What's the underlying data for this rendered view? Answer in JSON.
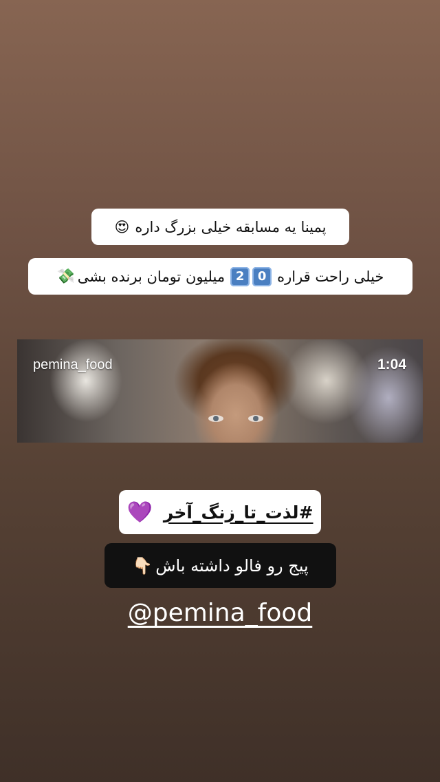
{
  "stickers": {
    "line1": {
      "text": "پمینا یه مسابقه خیلی بزرگ داره",
      "emoji": "😍"
    },
    "line2": {
      "text_before": "خیلی راحت قراره",
      "digit_1": "2",
      "digit_2": "0",
      "text_after": "میلیون تومان برنده بشی",
      "emoji": "💸"
    },
    "hashtag": {
      "text": "#لذت_تا_زنگ_آخر",
      "emoji": "💜"
    },
    "follow": {
      "text": "پیج رو فالو داشته باش",
      "emoji": "👇🏻"
    }
  },
  "video": {
    "username": "pemina_food",
    "duration": "1:04"
  },
  "mention": {
    "handle": "@pemina_food"
  },
  "colors": {
    "sticker_white": "#ffffff",
    "sticker_black": "#111111",
    "digit_key": "#4a7fc1"
  }
}
